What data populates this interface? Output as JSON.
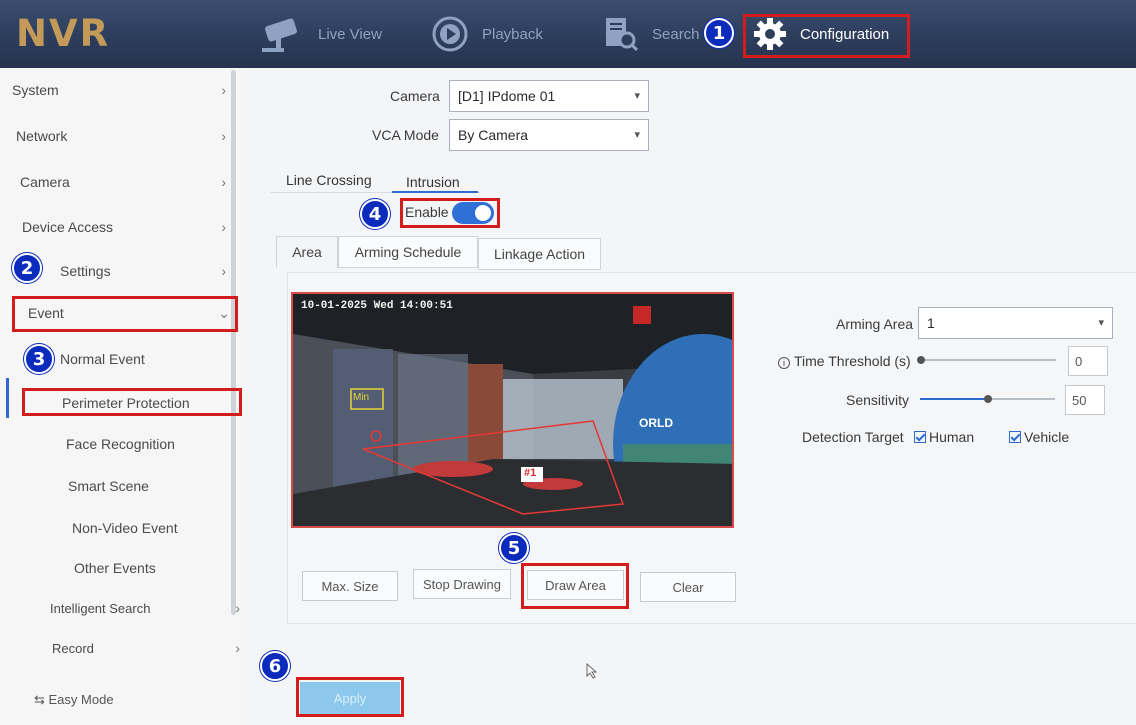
{
  "header": {
    "logo": "NVR",
    "nav": [
      {
        "label": "Live View",
        "icon": "camera-icon"
      },
      {
        "label": "Playback",
        "icon": "playback-icon"
      },
      {
        "label": "Search",
        "icon": "search-file-icon"
      },
      {
        "label": "Configuration",
        "icon": "gear-icon"
      }
    ]
  },
  "sidebar": {
    "items": [
      {
        "label": "System"
      },
      {
        "label": "Network"
      },
      {
        "label": "Camera"
      },
      {
        "label": "Device Access"
      },
      {
        "label": "Settings"
      },
      {
        "label": "Event"
      }
    ],
    "event_subitems": [
      "Normal Event",
      "Perimeter Protection",
      "Face Recognition",
      "Smart Scene",
      "Non-Video Event",
      "Other Events"
    ],
    "more_items": [
      {
        "label": "Intelligent Search"
      },
      {
        "label": "Record"
      }
    ],
    "easy_mode": "Easy Mode"
  },
  "main": {
    "camera_label": "Camera",
    "camera_value": "[D1] IPdome 01",
    "vca_label": "VCA Mode",
    "vca_value": "By Camera",
    "tabs": [
      "Line Crossing",
      "Intrusion"
    ],
    "enable_label": "Enable",
    "subtabs": [
      "Area",
      "Arming Schedule",
      "Linkage Action"
    ],
    "video_osd": "10-01-2025 Wed 14:00:51",
    "video_labels": {
      "min": "Min",
      "zone": "#1",
      "sign": "ORLD"
    },
    "arming_area_label": "Arming Area",
    "arming_area_value": "1",
    "time_threshold_label": "Time Threshold (s)",
    "time_threshold_value": "0",
    "sensitivity_label": "Sensitivity",
    "sensitivity_value": "50",
    "detection_target_label": "Detection Target",
    "target_human": "Human",
    "target_vehicle": "Vehicle",
    "buttons": [
      "Max. Size",
      "Stop Drawing",
      "Draw Area",
      "Clear"
    ],
    "apply": "Apply"
  },
  "callouts": [
    "1",
    "2",
    "3",
    "4",
    "5",
    "6"
  ],
  "colors": {
    "highlight": "#d31c1c",
    "callout": "#0b2bbd",
    "accent": "#2e6ad1",
    "topbar": "#2d3d5c",
    "logo": "#c39a59"
  }
}
